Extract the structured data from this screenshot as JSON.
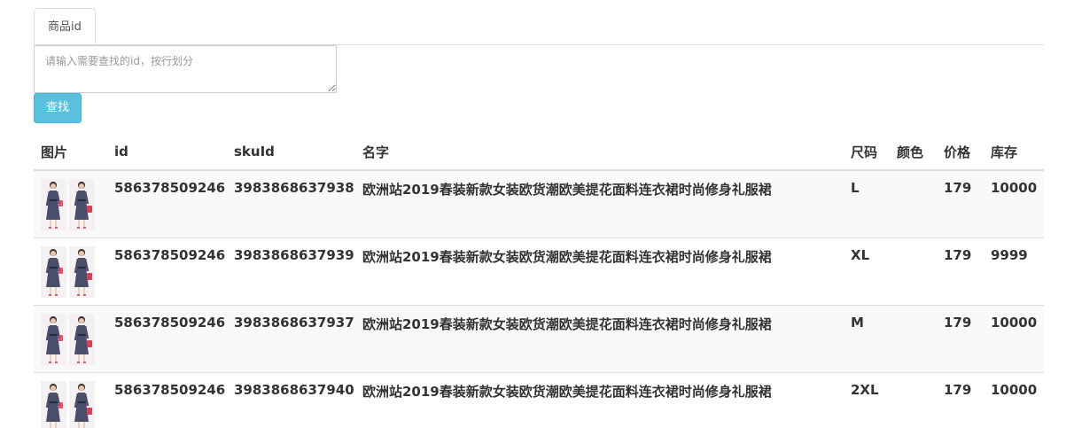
{
  "tabs": [
    {
      "label": "商品id"
    }
  ],
  "search": {
    "placeholder": "请输入需要查找的id，按行划分",
    "button_label": "查找"
  },
  "table": {
    "headers": [
      "图片",
      "id",
      "skuId",
      "名字",
      "尺码",
      "颜色",
      "价格",
      "库存"
    ],
    "rows": [
      {
        "image": "dress-thumbnail-icon",
        "id": "586378509246",
        "skuId": "3983868637938",
        "name": "欧洲站2019春装新款女装欧货潮欧美提花面料连衣裙时尚修身礼服裙",
        "size": "L",
        "color": "",
        "price": "179",
        "stock": "10000"
      },
      {
        "image": "dress-thumbnail-icon",
        "id": "586378509246",
        "skuId": "3983868637939",
        "name": "欧洲站2019春装新款女装欧货潮欧美提花面料连衣裙时尚修身礼服裙",
        "size": "XL",
        "color": "",
        "price": "179",
        "stock": "9999"
      },
      {
        "image": "dress-thumbnail-icon",
        "id": "586378509246",
        "skuId": "3983868637937",
        "name": "欧洲站2019春装新款女装欧货潮欧美提花面料连衣裙时尚修身礼服裙",
        "size": "M",
        "color": "",
        "price": "179",
        "stock": "10000"
      },
      {
        "image": "dress-thumbnail-icon",
        "id": "586378509246",
        "skuId": "3983868637940",
        "name": "欧洲站2019春装新款女装欧货潮欧美提花面料连衣裙时尚修身礼服裙",
        "size": "2XL",
        "color": "",
        "price": "179",
        "stock": "10000"
      }
    ]
  },
  "colors": {
    "button": "#5bc0de",
    "border": "#dddddd",
    "stripe": "#f9f9f9",
    "dress_dark": "#4a4e6a",
    "bag_red": "#d8405a"
  }
}
